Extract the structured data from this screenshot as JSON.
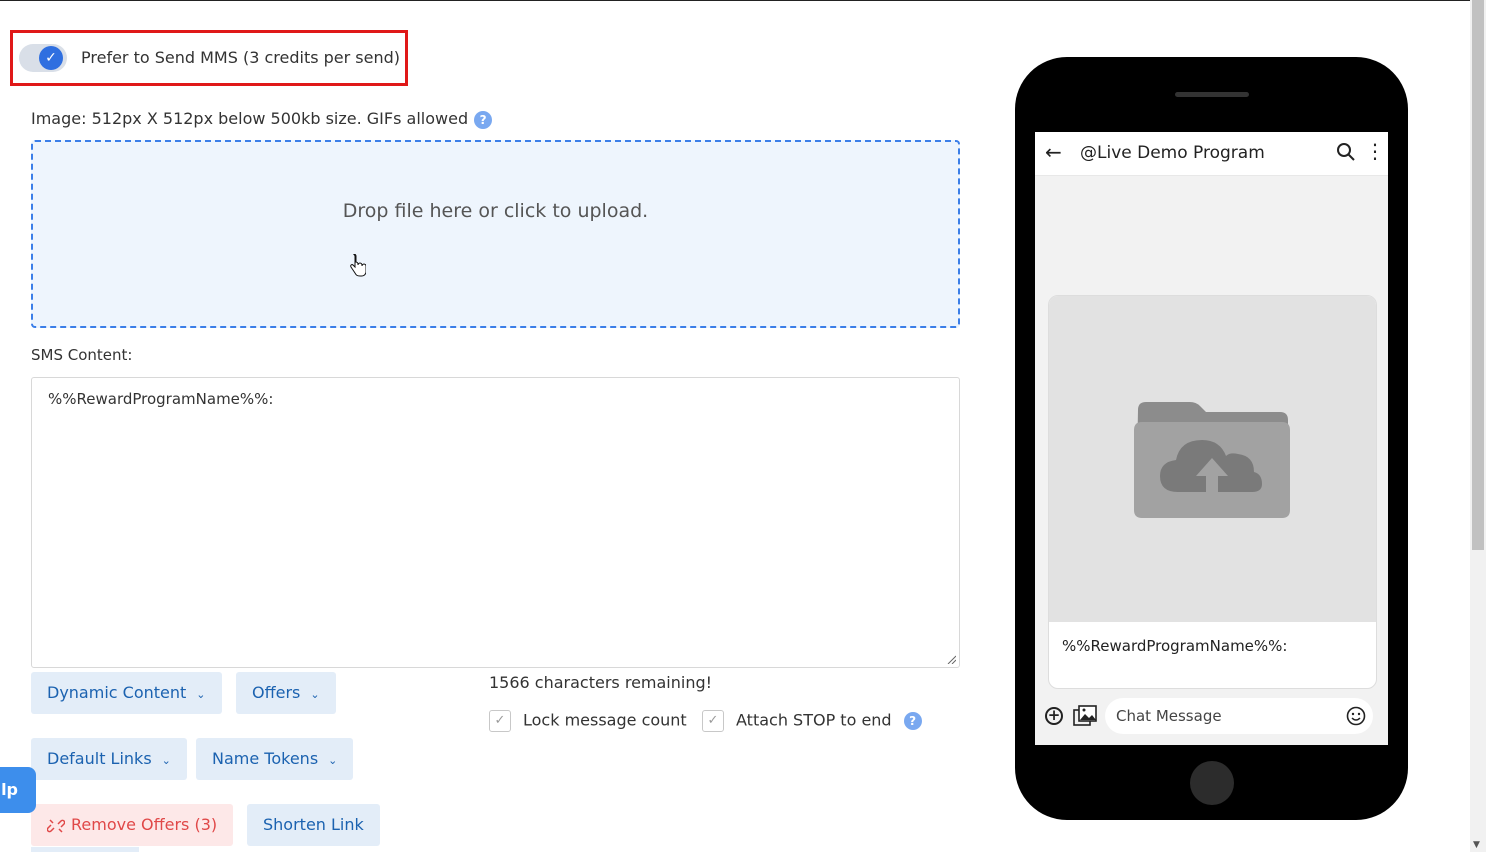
{
  "mms_toggle": {
    "label": "Prefer to Send MMS (3 credits per send)",
    "checked": true,
    "checkmark": "✓"
  },
  "image_note": {
    "text": "Image: 512px X 512px below 500kb size. GIFs allowed",
    "help": "?"
  },
  "dropzone": {
    "text": "Drop file here or click to upload."
  },
  "sms": {
    "label": "SMS Content:",
    "value": "%%RewardProgramName%%:"
  },
  "buttons": {
    "dynamic_content": "Dynamic Content",
    "offers": "Offers",
    "default_links": "Default Links",
    "name_tokens": "Name Tokens",
    "remove_offers": "Remove Offers (3)",
    "shorten_link": "Shorten Link"
  },
  "chars_remaining": "1566 characters remaining!",
  "checkboxes": {
    "lock_count": "Lock message count",
    "attach_stop": "Attach STOP to end",
    "help": "?"
  },
  "help_tab": "lp",
  "phone": {
    "title": "@Live Demo Program",
    "message": "%%RewardProgramName%%:",
    "input_placeholder": "Chat Message",
    "plus": "+"
  },
  "colors": {
    "accent": "#2f6fe0",
    "highlight": "#e01818",
    "button_bg": "#e3edf8",
    "button_text": "#1b62b0",
    "danger": "#e04848"
  },
  "icons": [
    "check-icon",
    "help-icon",
    "hand-cursor-icon",
    "chevron-down-icon",
    "unlink-icon",
    "back-arrow-icon",
    "search-icon",
    "more-vertical-icon",
    "cloud-upload-folder-icon",
    "plus-circle-icon",
    "gallery-icon",
    "smile-icon"
  ]
}
